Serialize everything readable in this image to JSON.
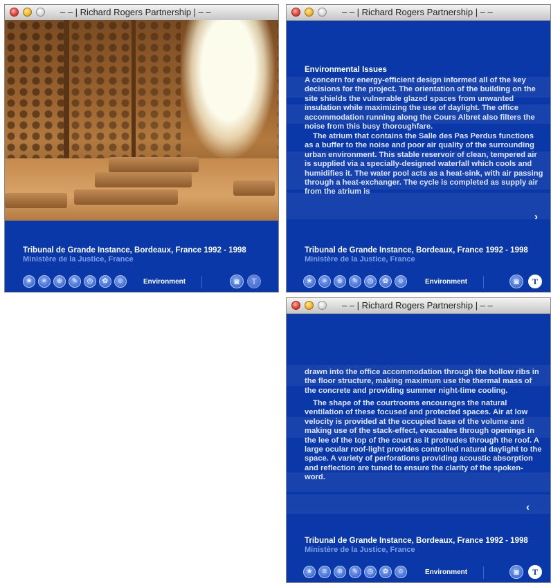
{
  "windows": [
    {
      "title": "– – | Richard Rogers Partnership | – –",
      "mode": "photo",
      "project_title": "Tribunal de Grande Instance, Bordeaux, France  1992 - 1998",
      "client": "Ministère de la Justice, France",
      "section_label": "Environment"
    },
    {
      "title": "– – | Richard Rogers Partnership | – –",
      "mode": "text",
      "heading": "Environmental Issues",
      "paragraphs": [
        "A concern for energy-efficient design informed all of the key decisions for the project. The orientation of the building on the site shields the vulnerable glazed spaces from unwanted insulation while maximizing the use of daylight. The office accommodation running along the Cours Albret also filters the noise from this busy thoroughfare.",
        "The atrium that contains the Salle des Pas Perdus functions as a buffer to the noise and poor air quality of the surrounding urban environment. This stable reservoir of clean, tempered air is supplied via a specially-designed waterfall which cools and humidifies it. The water pool acts as a heat-sink, with air passing through a heat-exchanger. The cycle is completed as supply air from the atrium is"
      ],
      "nav_arrow": "›",
      "project_title": "Tribunal de Grande Instance, Bordeaux, France  1992 - 1998",
      "client": "Ministère de la Justice, France",
      "section_label": "Environment"
    },
    {
      "title": "– – | Richard Rogers Partnership | – –",
      "mode": "text",
      "paragraphs": [
        "drawn into the office accommodation through the hollow ribs in the floor structure, making maximum use the thermal mass of the concrete and providing summer night-time cooling.",
        "The shape of the courtrooms encourages the natural ventilation of these focused and protected spaces. Air at low velocity is provided at the occupied base of the volume and making use of the stack-effect, evacuates through openings in the lee of the top of the court as it protrudes through the roof. A large ocular roof-light provides controlled natural daylight to the space. A variety of perforations providing acoustic absorption and reflection are tuned to ensure the clarity of the spoken-word."
      ],
      "nav_arrow": "‹",
      "project_title": "Tribunal de Grande Instance, Bordeaux, France  1992 - 1998",
      "client": "Ministère de la Justice, France",
      "section_label": "Environment"
    }
  ],
  "toolbar_icons": [
    "star-icon",
    "list-icon",
    "crosshair-icon",
    "wrench-icon",
    "clock-icon",
    "flower-icon",
    "person-icon"
  ],
  "toolbar_right_icons": [
    "camera-icon",
    "text-T-icon"
  ],
  "colors": {
    "window_blue": "#0a38a8",
    "client_blue": "#7fa0e8"
  }
}
